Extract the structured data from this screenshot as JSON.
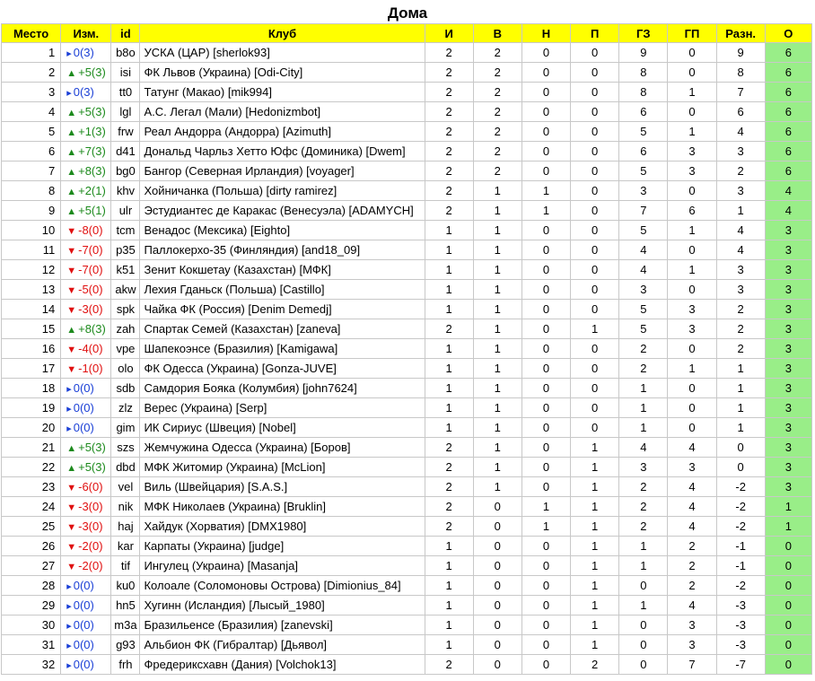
{
  "title": "Дома",
  "headers": [
    "Место",
    "Изм.",
    "id",
    "Клуб",
    "И",
    "В",
    "Н",
    "П",
    "ГЗ",
    "ГП",
    "Разн.",
    "О"
  ],
  "colors": {
    "header_bg": "#ffff00",
    "points_bg": "#99ee88",
    "up": "#1d8a1d",
    "down": "#e01010",
    "same": "#1a3fd6"
  },
  "rows": [
    {
      "pos": "1",
      "dir": "same",
      "chg": "0(3)",
      "id": "b8o",
      "club": "УСКА (ЦАР) [sherlok93]",
      "g": "2",
      "w": "2",
      "d": "0",
      "l": "0",
      "gf": "9",
      "ga": "0",
      "diff": "9",
      "pts": "6"
    },
    {
      "pos": "2",
      "dir": "up",
      "chg": "+5(3)",
      "id": "isi",
      "club": "ФК Львов (Украина) [Odi-City]",
      "g": "2",
      "w": "2",
      "d": "0",
      "l": "0",
      "gf": "8",
      "ga": "0",
      "diff": "8",
      "pts": "6"
    },
    {
      "pos": "3",
      "dir": "same",
      "chg": "0(3)",
      "id": "tt0",
      "club": "Татунг (Макао) [mik994]",
      "g": "2",
      "w": "2",
      "d": "0",
      "l": "0",
      "gf": "8",
      "ga": "1",
      "diff": "7",
      "pts": "6"
    },
    {
      "pos": "4",
      "dir": "up",
      "chg": "+5(3)",
      "id": "lgl",
      "club": "А.С. Легал (Мали) [Hedonizmbot]",
      "g": "2",
      "w": "2",
      "d": "0",
      "l": "0",
      "gf": "6",
      "ga": "0",
      "diff": "6",
      "pts": "6"
    },
    {
      "pos": "5",
      "dir": "up",
      "chg": "+1(3)",
      "id": "frw",
      "club": "Реал Андорра (Андорра) [Azimuth]",
      "g": "2",
      "w": "2",
      "d": "0",
      "l": "0",
      "gf": "5",
      "ga": "1",
      "diff": "4",
      "pts": "6"
    },
    {
      "pos": "6",
      "dir": "up",
      "chg": "+7(3)",
      "id": "d41",
      "club": "Дональд Чарльз Хетто Юфс (Доминика) [Dwem]",
      "g": "2",
      "w": "2",
      "d": "0",
      "l": "0",
      "gf": "6",
      "ga": "3",
      "diff": "3",
      "pts": "6"
    },
    {
      "pos": "7",
      "dir": "up",
      "chg": "+8(3)",
      "id": "bg0",
      "club": "Бангор (Северная Ирландия) [voyager]",
      "g": "2",
      "w": "2",
      "d": "0",
      "l": "0",
      "gf": "5",
      "ga": "3",
      "diff": "2",
      "pts": "6"
    },
    {
      "pos": "8",
      "dir": "up",
      "chg": "+2(1)",
      "id": "khv",
      "club": "Хойничанка (Польша) [dirty ramirez]",
      "g": "2",
      "w": "1",
      "d": "1",
      "l": "0",
      "gf": "3",
      "ga": "0",
      "diff": "3",
      "pts": "4"
    },
    {
      "pos": "9",
      "dir": "up",
      "chg": "+5(1)",
      "id": "ulr",
      "club": "Эстудиантес де Каракас (Венесуэла) [ADAMYCH]",
      "g": "2",
      "w": "1",
      "d": "1",
      "l": "0",
      "gf": "7",
      "ga": "6",
      "diff": "1",
      "pts": "4"
    },
    {
      "pos": "10",
      "dir": "down",
      "chg": "-8(0)",
      "id": "tcm",
      "club": "Венадос (Мексика) [Eighto]",
      "g": "1",
      "w": "1",
      "d": "0",
      "l": "0",
      "gf": "5",
      "ga": "1",
      "diff": "4",
      "pts": "3"
    },
    {
      "pos": "11",
      "dir": "down",
      "chg": "-7(0)",
      "id": "p35",
      "club": "Паллокерхо-35 (Финляндия) [and18_09]",
      "g": "1",
      "w": "1",
      "d": "0",
      "l": "0",
      "gf": "4",
      "ga": "0",
      "diff": "4",
      "pts": "3"
    },
    {
      "pos": "12",
      "dir": "down",
      "chg": "-7(0)",
      "id": "k51",
      "club": "Зенит Кокшетау (Казахстан) [МФК]",
      "g": "1",
      "w": "1",
      "d": "0",
      "l": "0",
      "gf": "4",
      "ga": "1",
      "diff": "3",
      "pts": "3"
    },
    {
      "pos": "13",
      "dir": "down",
      "chg": "-5(0)",
      "id": "akw",
      "club": "Лехия Гданьск (Польша) [Castillo]",
      "g": "1",
      "w": "1",
      "d": "0",
      "l": "0",
      "gf": "3",
      "ga": "0",
      "diff": "3",
      "pts": "3"
    },
    {
      "pos": "14",
      "dir": "down",
      "chg": "-3(0)",
      "id": "spk",
      "club": "Чайка ФК (Россия) [Denim Demedj]",
      "g": "1",
      "w": "1",
      "d": "0",
      "l": "0",
      "gf": "5",
      "ga": "3",
      "diff": "2",
      "pts": "3"
    },
    {
      "pos": "15",
      "dir": "up",
      "chg": "+8(3)",
      "id": "zah",
      "club": "Спартак Семей (Казахстан) [zaneva]",
      "g": "2",
      "w": "1",
      "d": "0",
      "l": "1",
      "gf": "5",
      "ga": "3",
      "diff": "2",
      "pts": "3"
    },
    {
      "pos": "16",
      "dir": "down",
      "chg": "-4(0)",
      "id": "vpe",
      "club": "Шапекоэнсе (Бразилия) [Kamigawa]",
      "g": "1",
      "w": "1",
      "d": "0",
      "l": "0",
      "gf": "2",
      "ga": "0",
      "diff": "2",
      "pts": "3"
    },
    {
      "pos": "17",
      "dir": "down",
      "chg": "-1(0)",
      "id": "olo",
      "club": "ФК Одесса (Украина) [Gonza-JUVE]",
      "g": "1",
      "w": "1",
      "d": "0",
      "l": "0",
      "gf": "2",
      "ga": "1",
      "diff": "1",
      "pts": "3"
    },
    {
      "pos": "18",
      "dir": "same",
      "chg": "0(0)",
      "id": "sdb",
      "club": "Самдория Бояка (Колумбия) [john7624]",
      "g": "1",
      "w": "1",
      "d": "0",
      "l": "0",
      "gf": "1",
      "ga": "0",
      "diff": "1",
      "pts": "3"
    },
    {
      "pos": "19",
      "dir": "same",
      "chg": "0(0)",
      "id": "zlz",
      "club": "Верес (Украина) [Serp]",
      "g": "1",
      "w": "1",
      "d": "0",
      "l": "0",
      "gf": "1",
      "ga": "0",
      "diff": "1",
      "pts": "3"
    },
    {
      "pos": "20",
      "dir": "same",
      "chg": "0(0)",
      "id": "gim",
      "club": "ИК Сириус (Швеция) [Nobel]",
      "g": "1",
      "w": "1",
      "d": "0",
      "l": "0",
      "gf": "1",
      "ga": "0",
      "diff": "1",
      "pts": "3"
    },
    {
      "pos": "21",
      "dir": "up",
      "chg": "+5(3)",
      "id": "szs",
      "club": "Жемчужина Одесса (Украина) [Боров]",
      "g": "2",
      "w": "1",
      "d": "0",
      "l": "1",
      "gf": "4",
      "ga": "4",
      "diff": "0",
      "pts": "3"
    },
    {
      "pos": "22",
      "dir": "up",
      "chg": "+5(3)",
      "id": "dbd",
      "club": "МФК Житомир (Украина) [McLion]",
      "g": "2",
      "w": "1",
      "d": "0",
      "l": "1",
      "gf": "3",
      "ga": "3",
      "diff": "0",
      "pts": "3"
    },
    {
      "pos": "23",
      "dir": "down",
      "chg": "-6(0)",
      "id": "vel",
      "club": "Виль (Швейцария) [S.A.S.]",
      "g": "2",
      "w": "1",
      "d": "0",
      "l": "1",
      "gf": "2",
      "ga": "4",
      "diff": "-2",
      "pts": "3"
    },
    {
      "pos": "24",
      "dir": "down",
      "chg": "-3(0)",
      "id": "nik",
      "club": "МФК Николаев (Украина) [Bruklin]",
      "g": "2",
      "w": "0",
      "d": "1",
      "l": "1",
      "gf": "2",
      "ga": "4",
      "diff": "-2",
      "pts": "1"
    },
    {
      "pos": "25",
      "dir": "down",
      "chg": "-3(0)",
      "id": "haj",
      "club": "Хайдук (Хорватия) [DMX1980]",
      "g": "2",
      "w": "0",
      "d": "1",
      "l": "1",
      "gf": "2",
      "ga": "4",
      "diff": "-2",
      "pts": "1"
    },
    {
      "pos": "26",
      "dir": "down",
      "chg": "-2(0)",
      "id": "kar",
      "club": "Карпаты (Украина) [judge]",
      "g": "1",
      "w": "0",
      "d": "0",
      "l": "1",
      "gf": "1",
      "ga": "2",
      "diff": "-1",
      "pts": "0"
    },
    {
      "pos": "27",
      "dir": "down",
      "chg": "-2(0)",
      "id": "tif",
      "club": "Ингулец (Украина) [Masanja]",
      "g": "1",
      "w": "0",
      "d": "0",
      "l": "1",
      "gf": "1",
      "ga": "2",
      "diff": "-1",
      "pts": "0"
    },
    {
      "pos": "28",
      "dir": "same",
      "chg": "0(0)",
      "id": "ku0",
      "club": "Колоале (Соломоновы Острова) [Dimionius_84]",
      "g": "1",
      "w": "0",
      "d": "0",
      "l": "1",
      "gf": "0",
      "ga": "2",
      "diff": "-2",
      "pts": "0"
    },
    {
      "pos": "29",
      "dir": "same",
      "chg": "0(0)",
      "id": "hn5",
      "club": "Хугинн (Исландия) [Лысый_1980]",
      "g": "1",
      "w": "0",
      "d": "0",
      "l": "1",
      "gf": "1",
      "ga": "4",
      "diff": "-3",
      "pts": "0"
    },
    {
      "pos": "30",
      "dir": "same",
      "chg": "0(0)",
      "id": "m3a",
      "club": "Бразильенсе (Бразилия) [zanevski]",
      "g": "1",
      "w": "0",
      "d": "0",
      "l": "1",
      "gf": "0",
      "ga": "3",
      "diff": "-3",
      "pts": "0"
    },
    {
      "pos": "31",
      "dir": "same",
      "chg": "0(0)",
      "id": "g93",
      "club": "Альбион ФК (Гибралтар) [Дьявол]",
      "g": "1",
      "w": "0",
      "d": "0",
      "l": "1",
      "gf": "0",
      "ga": "3",
      "diff": "-3",
      "pts": "0"
    },
    {
      "pos": "32",
      "dir": "same",
      "chg": "0(0)",
      "id": "frh",
      "club": "Фредериксхавн (Дания) [Volchok13]",
      "g": "2",
      "w": "0",
      "d": "0",
      "l": "2",
      "gf": "0",
      "ga": "7",
      "diff": "-7",
      "pts": "0"
    }
  ]
}
